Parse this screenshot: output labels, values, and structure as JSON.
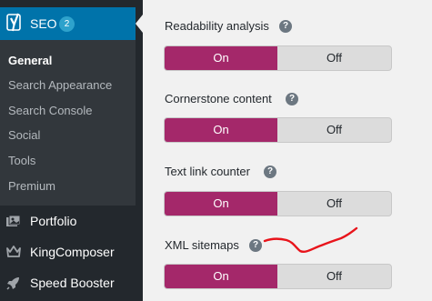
{
  "sidebar": {
    "seo": {
      "label": "SEO",
      "badge": "2"
    },
    "submenu": [
      "General",
      "Search Appearance",
      "Search Console",
      "Social",
      "Tools",
      "Premium"
    ],
    "active_submenu": "General",
    "menu_items": [
      {
        "label": "Portfolio",
        "icon": "portfolio-icon"
      },
      {
        "label": "KingComposer",
        "icon": "kingcomposer-icon"
      },
      {
        "label": "Speed Booster",
        "icon": "rocket-icon"
      }
    ]
  },
  "settings": [
    {
      "label": "Readability analysis",
      "help": "?",
      "on": "On",
      "off": "Off",
      "value": "on"
    },
    {
      "label": "Cornerstone content",
      "help": "?",
      "on": "On",
      "off": "Off",
      "value": "on"
    },
    {
      "label": "Text link counter",
      "help": "?",
      "on": "On",
      "off": "Off",
      "value": "on"
    },
    {
      "label": "XML sitemaps",
      "help": "?",
      "on": "On",
      "off": "Off",
      "value": "on"
    }
  ],
  "colors": {
    "sidebar_bg": "#23282d",
    "submenu_bg": "#32373c",
    "seo_active_bg": "#0073aa",
    "toggle_on": "#a4286a",
    "annotation": "#e8141b"
  }
}
